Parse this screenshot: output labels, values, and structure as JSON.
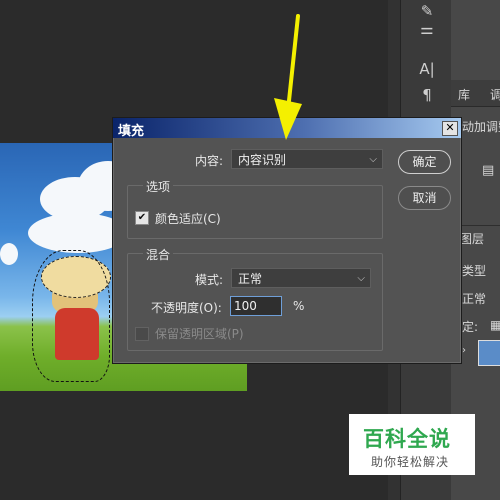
{
  "dialog": {
    "title": "填充",
    "close_label": "✕",
    "content_label": "内容:",
    "content_value": "内容识别",
    "ok_label": "确定",
    "cancel_label": "取消",
    "options_group": "选项",
    "color_adapt_label": "颜色适应(C)",
    "color_adapt_checked": true,
    "blend_group": "混合",
    "mode_label": "模式:",
    "mode_value": "正常",
    "opacity_label": "不透明度(O):",
    "opacity_value": "100",
    "opacity_unit": "%",
    "preserve_label": "保留透明区域(P)",
    "preserve_checked": false
  },
  "right_panel": {
    "tab_library": "库",
    "tab_partial": "调",
    "adjust_text": "动加调整",
    "layers_tab": "图层",
    "kind_label": "类型",
    "blend_value": "正常",
    "lock_label": "定:"
  },
  "tools": {
    "brush_icon": "brush-icon",
    "sliders_icon": "adjust-sliders-icon",
    "text_icon": "text-tool-icon",
    "paragraph_icon": "paragraph-icon"
  },
  "tool_glyphs": {
    "brush": "✎",
    "sliders": "⚌",
    "text": "A|",
    "paragraph": "¶"
  },
  "watermark": {
    "title": "百科全说",
    "subtitle": "助你轻松解决"
  },
  "colors": {
    "arrow": "#f4f000",
    "title_start": "#0a246a",
    "title_end": "#a6caf0",
    "watermark_green": "#2fa84f"
  }
}
